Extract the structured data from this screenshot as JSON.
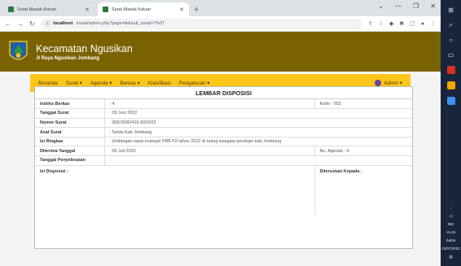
{
  "browser": {
    "tabs": [
      {
        "label": "Surat Masuk Keluar",
        "active": false
      },
      {
        "label": "Surat Masuk Keluar",
        "active": true
      }
    ],
    "new_tab": "+",
    "url_host": "localhost",
    "url_path": "/surat/admin.php?page=tk&sub_surat=7%27"
  },
  "header": {
    "site_title": "Kecamatan Ngusikan",
    "site_address": "Jl Raya Ngusikan Jombang"
  },
  "navbar": {
    "items": [
      "Beranda",
      "Surat ▾",
      "Agenda ▾",
      "Berkas ▾",
      "Klasifikasi",
      "Pengaturan ▾"
    ],
    "admin_label": "Admin ▾"
  },
  "disposisi": {
    "title": "LEMBAR DISPOSISI",
    "indeks_label": "Indeks Berkas",
    "indeks_value": ": 4",
    "kode_label": "Kode : 002",
    "tanggal_surat_label": "Tanggal Surat",
    "tanggal_surat_value": ": 09 Juni 2022",
    "nomor_surat_label": "Nomor Surat",
    "nomor_surat_value": ": 005/3936/415.43/2022",
    "asal_surat_label": "Asal Surat",
    "asal_surat_value": ": Setda Kab Jombang",
    "isi_ringkas_label": "Isi Ringkas",
    "isi_ringkas_value": ": Undangan rapat evaluasi PBB P2 tahun 2022 di ruang swagata pendopo kab Jombang",
    "diterima_label": "Diterima Tanggal",
    "diterima_value": ": 06 Juli 2022",
    "no_agenda_label": "No. Agenda : 4",
    "penyelesaian_label": "Tanggal Penyelesaian",
    "penyelesaian_value": ":",
    "isi_disposisi_label": "Isi Disposisi :",
    "diteruskan_label": "Diteruskan Kepada :"
  },
  "taskbar": {
    "lang": "IND",
    "time": "15.25",
    "day": "Sabtu",
    "date": "23/07/2022"
  },
  "colors": {
    "header_bg": "#7a6200",
    "navbar_bg": "#ffc61a",
    "taskbar_bg": "#17263c"
  }
}
